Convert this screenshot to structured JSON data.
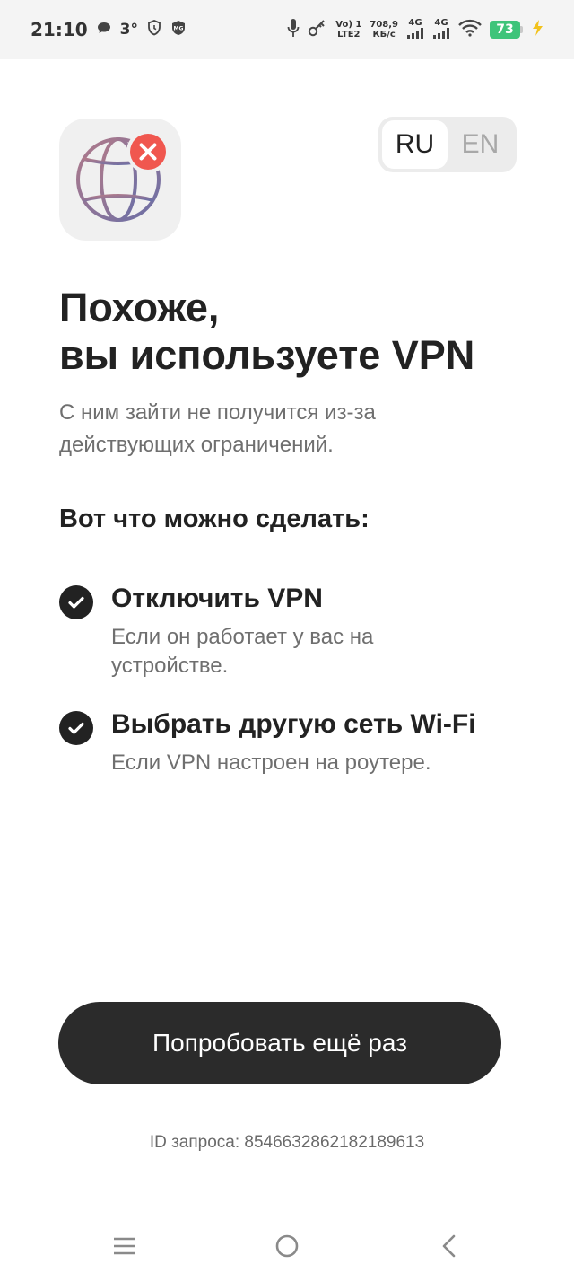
{
  "status_bar": {
    "time": "21:10",
    "temperature": "3°",
    "volte_line1": "Vo) 1",
    "volte_line2": "LTE2",
    "speed_value": "708,9",
    "speed_unit": "КБ/с",
    "net1": "4G",
    "net2": "4G",
    "battery": "73",
    "battery_color": "#3ec47a"
  },
  "language": {
    "options": [
      "RU",
      "EN"
    ],
    "selected": "RU"
  },
  "main": {
    "title_line1": "Похоже,",
    "title_line2": "вы используете VPN",
    "subtitle": "С ним зайти не получится из-за действующих ограничений.",
    "section_title": "Вот что можно сделать:",
    "tips": [
      {
        "title": "Отключить VPN",
        "description": "Если он работает у вас на устройстве."
      },
      {
        "title": "Выбрать другую сеть Wi-Fi",
        "description": "Если VPN настроен на роутере."
      }
    ],
    "retry_label": "Попробовать ещё раз",
    "request_id": "ID запроса: 8546632862182189613"
  },
  "icons": {
    "app_icon": "globe-with-error-icon",
    "error_badge_color": "#f0574f",
    "nav": [
      "menu-icon",
      "home-circle-icon",
      "back-chevron-icon"
    ]
  }
}
